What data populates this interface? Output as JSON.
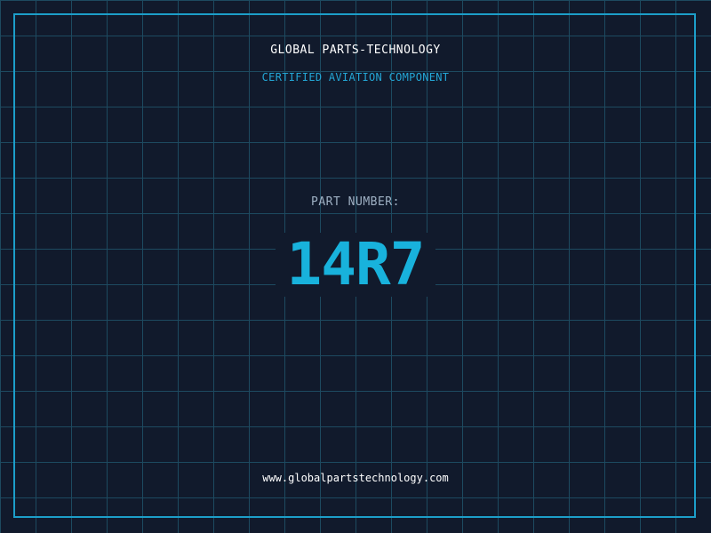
{
  "brand": {
    "name": "GLOBAL PARTS-TECHNOLOGY",
    "tagline": "CERTIFIED AVIATION COMPONENT"
  },
  "part": {
    "label": "PART NUMBER:",
    "number": "14R7"
  },
  "footer": {
    "website": "www.globalpartstechnology.com"
  },
  "colors": {
    "background": "#111a2c",
    "grid": "#1d4a60",
    "frame": "#1c9ec9",
    "accent": "#18b2dc",
    "label": "#9fb1c4",
    "text": "#ffffff"
  }
}
